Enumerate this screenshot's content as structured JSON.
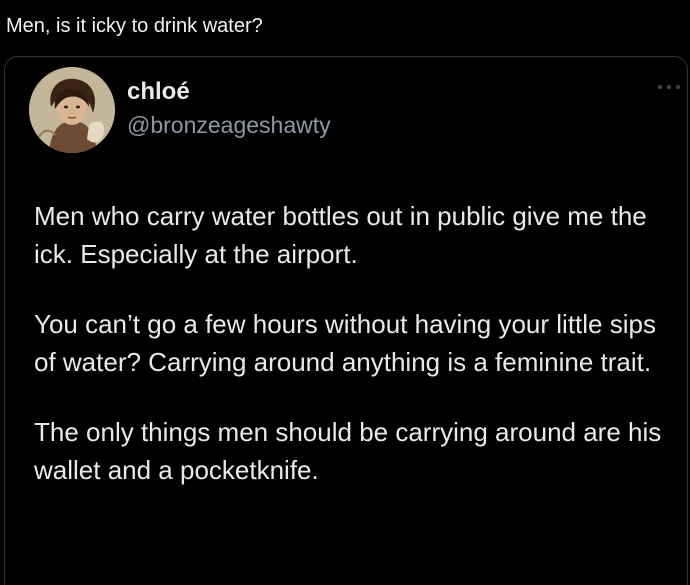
{
  "caption": "Men, is it icky to drink water?",
  "tweet": {
    "display_name": "chloé",
    "handle": "@bronzeageshawty",
    "more_icon": "more-horizontal-icon",
    "paragraphs": [
      "Men who carry water bottles out in public give me the ick. Especially at the airport.",
      "You can’t go a few hours without having your little sips of water? Carrying around anything is a feminine trait.",
      "The only things men should be carrying around are his wallet and a pocketknife."
    ]
  },
  "colors": {
    "background": "#000000",
    "text": "#e7e9ea",
    "handle": "#8b98a5",
    "border": "#2f3336"
  }
}
